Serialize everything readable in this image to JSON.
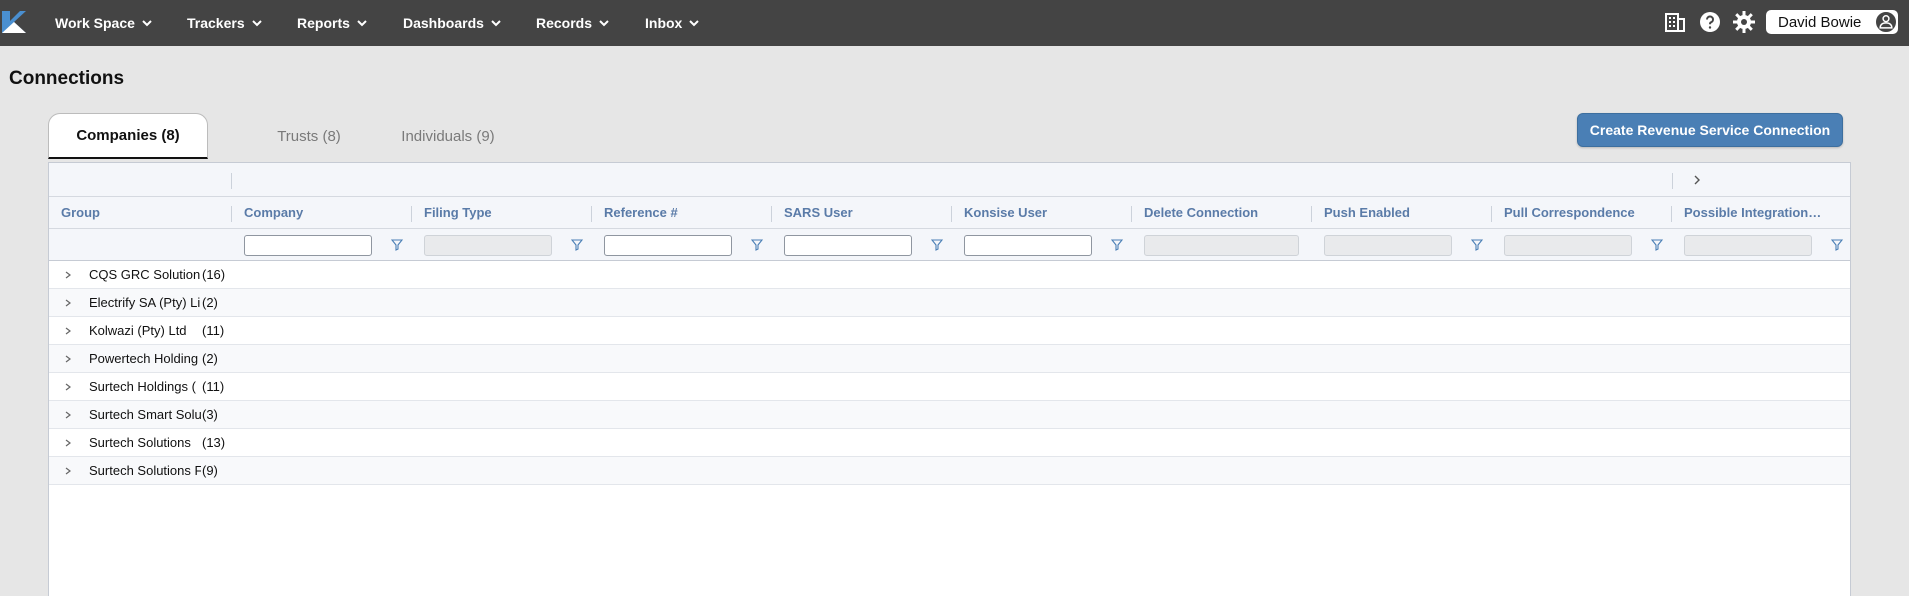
{
  "nav": {
    "items": [
      {
        "label": "Work Space"
      },
      {
        "label": "Trackers"
      },
      {
        "label": "Reports"
      },
      {
        "label": "Dashboards"
      },
      {
        "label": "Records"
      },
      {
        "label": "Inbox"
      }
    ],
    "user_name": "David Bowie"
  },
  "icons": {
    "logo": "konsise-logo-icon",
    "calendar": "building-calendar-icon",
    "help": "help-circle-icon",
    "settings": "gear-icon",
    "user": "user-icon"
  },
  "page": {
    "title": "Connections"
  },
  "tabs": [
    {
      "label": "Companies (8)",
      "active": true
    },
    {
      "label": "Trusts (8)",
      "active": false
    },
    {
      "label": "Individuals (9)",
      "active": false
    }
  ],
  "actions": {
    "create_label": "Create Revenue Service Connection"
  },
  "grid": {
    "columns": [
      "Group",
      "Company",
      "Filing Type",
      "Reference #",
      "SARS User",
      "Konsise User",
      "Delete Connection",
      "Push Enabled",
      "Pull Correspondence",
      "Possible Integration Is..."
    ],
    "rows": [
      {
        "name": "CQS GRC Solution",
        "count": "(16)"
      },
      {
        "name": "Electrify SA (Pty) Li",
        "count": "(2)"
      },
      {
        "name": "Kolwazi (Pty) Ltd",
        "count": "(11)"
      },
      {
        "name": "Powertech Holding",
        "count": "(2)"
      },
      {
        "name": "Surtech Holdings (",
        "count": "(11)"
      },
      {
        "name": "Surtech Smart Solu",
        "count": "(3)"
      },
      {
        "name": "Surtech Solutions ",
        "count": "(13)"
      },
      {
        "name": "Surtech Solutions F",
        "count": "(9)"
      }
    ]
  },
  "colors": {
    "topbar": "#444444",
    "accent": "#4a7fb5",
    "header_text": "#5a7ba8"
  }
}
